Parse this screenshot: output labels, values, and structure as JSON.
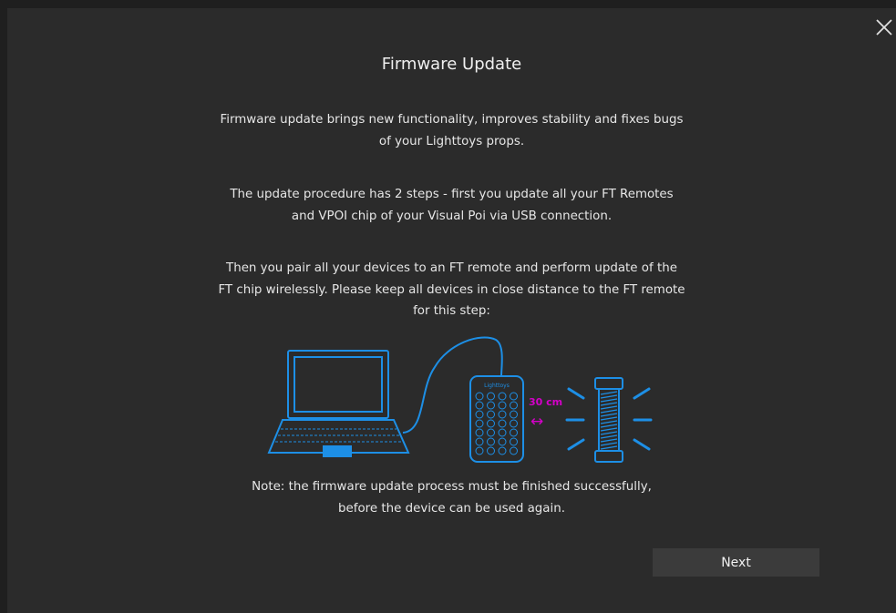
{
  "dialog": {
    "title": "Firmware Update",
    "close_icon": "close-icon",
    "intro": {
      "line1": "Firmware update brings new functionality, improves stability and fixes bugs",
      "line2": "of your Lighttoys props."
    },
    "steps": {
      "line1": "The update procedure has 2 steps - first you update all your FT Remotes",
      "line2": "and VPOI chip of your Visual Poi via USB connection."
    },
    "pairing": {
      "line1": "Then you pair all your devices to an FT remote and perform update of the",
      "line2": "FT chip wirelessly. Please keep all devices in close distance to the FT remote",
      "line3": "for this step:"
    },
    "illustration": {
      "remote_brand": "Lighttoys",
      "distance_label": "30 cm",
      "distance_arrow": "↔",
      "accent_color": "#1d8fe6",
      "distance_color": "#d400c8"
    },
    "note": {
      "line1": "Note: the firmware update process must be finished successfully,",
      "line2": "before the device can be used again."
    },
    "next_label": "Next"
  }
}
